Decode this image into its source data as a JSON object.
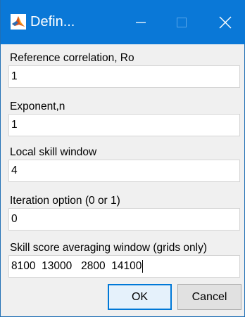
{
  "window": {
    "title": "Defin...",
    "accent_color": "#0a78d7"
  },
  "titlebar_controls": {
    "minimize_icon": "minimize-icon",
    "maximize_icon": "maximize-icon",
    "close_icon": "close-icon"
  },
  "fields": [
    {
      "label": "Reference correlation, Ro",
      "value": "1"
    },
    {
      "label": "Exponent,n",
      "value": "1"
    },
    {
      "label": "Local skill window",
      "value": "4"
    },
    {
      "label": "Iteration option (0 or 1)",
      "value": "0"
    },
    {
      "label": "Skill score averaging window (grids only)",
      "value": "8100  13000   2800  14100"
    }
  ],
  "buttons": {
    "ok": "OK",
    "cancel": "Cancel"
  }
}
